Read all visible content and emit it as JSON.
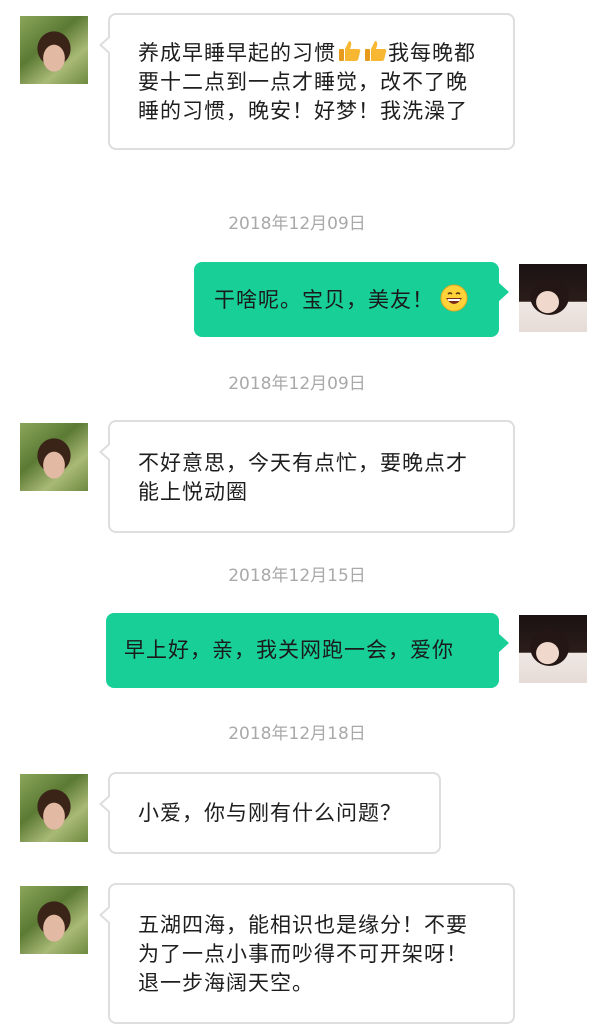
{
  "messages": [
    {
      "side": "in",
      "text_before": "养成早睡早起的习惯",
      "text_after": "我每晚都要十二点到一点才睡觉，改不了晚睡的习惯，晚安！好梦！我洗澡了",
      "icons": [
        "thumbs-up-icon",
        "thumbs-up-icon"
      ]
    },
    {
      "timestamp": "2018年12月09日"
    },
    {
      "side": "out",
      "text": "干啥呢。宝贝，美友！",
      "icons": [
        "grin-emoji-icon"
      ]
    },
    {
      "timestamp": "2018年12月09日"
    },
    {
      "side": "in",
      "text": "不好意思，今天有点忙，要晚点才能上悦动圈"
    },
    {
      "timestamp": "2018年12月15日"
    },
    {
      "side": "out",
      "text": "早上好，亲，我关网跑一会，爱你"
    },
    {
      "timestamp": "2018年12月18日"
    },
    {
      "side": "in",
      "text": "小爱，你与刚有什么问题？"
    },
    {
      "side": "in",
      "text": "五湖四海，能相识也是缘分！不要为了一点小事而吵得不可开架呀！退一步海阔天空。"
    }
  ],
  "colors": {
    "outgoing_bubble": "#18cf98",
    "incoming_bubble": "#ffffff",
    "incoming_border": "#dedede",
    "timestamp_text": "#a9a9a9"
  }
}
